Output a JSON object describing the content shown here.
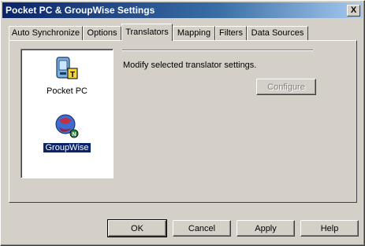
{
  "window": {
    "title": "Pocket PC & GroupWise Settings",
    "close_glyph": "X"
  },
  "tabs": [
    {
      "label": "Auto Synchronize",
      "active": false
    },
    {
      "label": "Options",
      "active": false
    },
    {
      "label": "Translators",
      "active": true
    },
    {
      "label": "Mapping",
      "active": false
    },
    {
      "label": "Filters",
      "active": false
    },
    {
      "label": "Data Sources",
      "active": false
    }
  ],
  "translators": {
    "items": [
      {
        "label": "Pocket PC",
        "icon": "pocket-pc-icon",
        "selected": false
      },
      {
        "label": "GroupWise",
        "icon": "groupwise-icon",
        "selected": true
      }
    ],
    "description": "Modify selected translator settings.",
    "configure_label": "Configure",
    "configure_enabled": false
  },
  "buttons": {
    "ok": "OK",
    "cancel": "Cancel",
    "apply": "Apply",
    "help": "Help"
  },
  "colors": {
    "title_gradient_start": "#0a246a",
    "title_gradient_end": "#a6caf0",
    "face": "#d4d0c8",
    "selection": "#0a246a"
  }
}
